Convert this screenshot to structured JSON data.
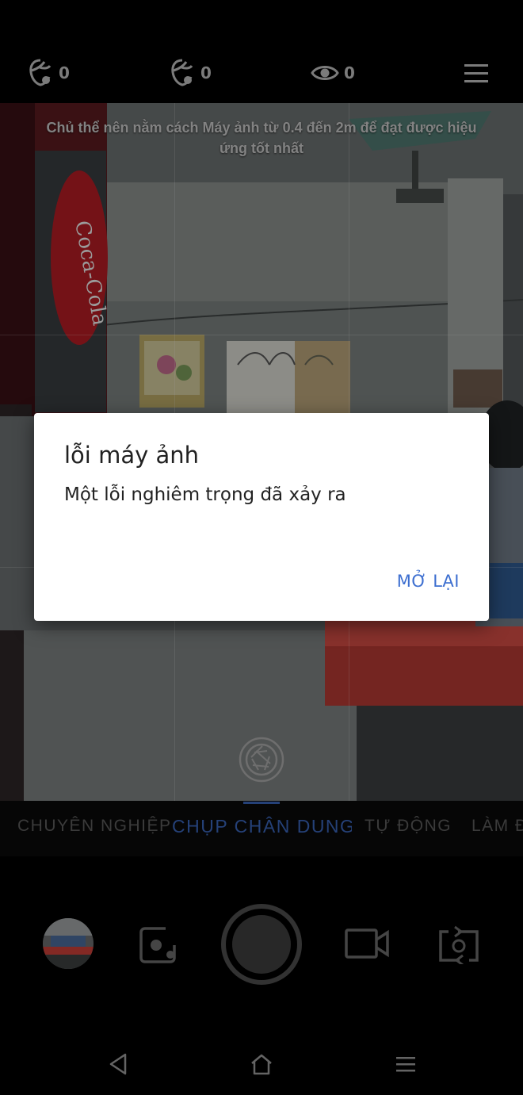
{
  "topbar": {
    "counter1": "0",
    "counter2": "0",
    "counter3": "0"
  },
  "viewfinder": {
    "hint": "Chủ thể nên nằm cách Máy ảnh từ 0.4 đến 2m để đạt được hiệu ứng tốt nhất"
  },
  "modes": {
    "items": [
      "CHUYÊN NGHIỆP",
      "CHỤP CHÂN DUNG",
      "TỰ ĐỘNG",
      "LÀM Đ"
    ],
    "active_index": 1
  },
  "dialog": {
    "title": "lỗi máy ảnh",
    "message": "Một lỗi nghiêm trọng đã xảy ra",
    "button": "MỞ LẠI"
  },
  "colors": {
    "accent": "#3d6fd0",
    "mode_active": "#3a64b8"
  },
  "icons": {
    "top": [
      "beauty-face-icon",
      "beauty-face-icon",
      "eye-icon",
      "menu-icon"
    ],
    "bottom": [
      "gallery-thumbnail",
      "photo-mode-icon",
      "shutter-button",
      "video-icon",
      "switch-camera-icon"
    ],
    "nav": [
      "back-icon",
      "home-icon",
      "recents-icon"
    ]
  }
}
